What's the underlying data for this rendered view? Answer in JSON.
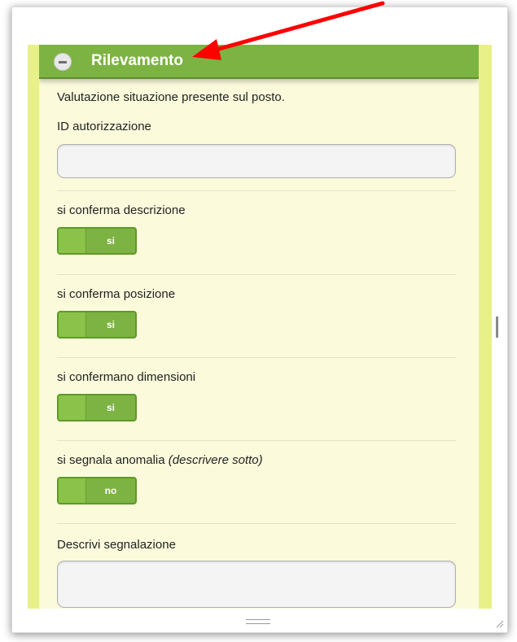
{
  "section": {
    "title": "Rilevamento",
    "description": "Valutazione situazione presente sul posto."
  },
  "fields": {
    "id_label": "ID autorizzazione",
    "id_value": "",
    "descrizione_label": "si conferma descrizione",
    "descrizione_toggle": "si",
    "posizione_label": "si conferma posizione",
    "posizione_toggle": "si",
    "dimensioni_label": "si confermano dimensioni",
    "dimensioni_toggle": "si",
    "anomalia_label": "si segnala anomalia",
    "anomalia_hint": "(descrivere sotto)",
    "anomalia_toggle": "no",
    "segnalazione_label": "Descrivi segnalazione",
    "segnalazione_value": ""
  },
  "icons": {
    "collapse": "minus-circle-icon",
    "resize": "resize-handle-icon"
  },
  "colors": {
    "header": "#7cb342",
    "panel_background": "#fbfbdc",
    "side_band": "#e8f08a",
    "annotation_arrow": "#ff0000"
  }
}
